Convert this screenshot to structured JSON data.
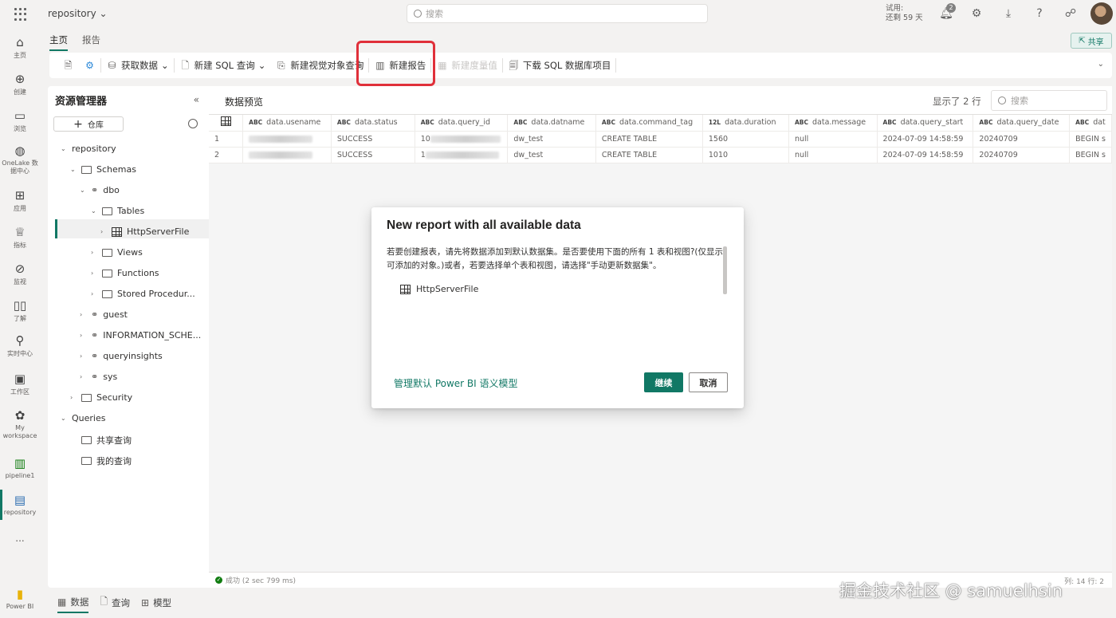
{
  "header": {
    "app_title": "repository",
    "search_placeholder": "搜索",
    "trial_line1": "试用:",
    "trial_line2": "还剩 59 天",
    "notification_count": "2"
  },
  "left_rail": {
    "items": [
      {
        "label": "主页",
        "icon": "home-icon"
      },
      {
        "label": "创建",
        "icon": "create-icon"
      },
      {
        "label": "浏览",
        "icon": "browse-icon"
      },
      {
        "label": "OneLake 数据中心",
        "icon": "onelake-icon"
      },
      {
        "label": "应用",
        "icon": "apps-icon"
      },
      {
        "label": "指标",
        "icon": "trophy-icon"
      },
      {
        "label": "监视",
        "icon": "monitor-icon"
      },
      {
        "label": "了解",
        "icon": "book-icon"
      },
      {
        "label": "实时中心",
        "icon": "realtime-icon"
      },
      {
        "label": "工作区",
        "icon": "workspaces-icon"
      },
      {
        "label": "My workspace",
        "icon": "my-workspace-icon"
      },
      {
        "label": "pipeline1",
        "icon": "pipeline-icon"
      },
      {
        "label": "repository",
        "icon": "warehouse-icon"
      },
      {
        "label": "...",
        "icon": "more-icon"
      },
      {
        "label": "Power BI",
        "icon": "powerbi-icon"
      }
    ]
  },
  "tabs": {
    "home": "主页",
    "report": "报告",
    "share": "共享"
  },
  "toolbar": {
    "get_data": "获取数据",
    "new_sql_query": "新建 SQL 查询",
    "new_visual_query": "新建视觉对象查询",
    "new_report": "新建报告",
    "new_measure": "新建度量值",
    "download_sql_project": "下载 SQL 数据库项目"
  },
  "explorer": {
    "title": "资源管理器",
    "add_warehouse": "仓库",
    "tree": {
      "repository": "repository",
      "schemas": "Schemas",
      "dbo": "dbo",
      "tables": "Tables",
      "httpserverfile": "HttpServerFile",
      "views": "Views",
      "functions": "Functions",
      "stored_procedures": "Stored Procedur...",
      "guest": "guest",
      "information_schema": "INFORMATION_SCHE...",
      "queryinsights": "queryinsights",
      "sys": "sys",
      "security": "Security",
      "queries": "Queries",
      "shared_queries": "共享查询",
      "my_queries": "我的查询"
    }
  },
  "preview": {
    "title": "数据预览",
    "rows_shown": "显示了 2 行",
    "search_placeholder": "搜索",
    "columns": [
      {
        "type": "ABC",
        "name": "data.usename"
      },
      {
        "type": "ABC",
        "name": "data.status"
      },
      {
        "type": "ABC",
        "name": "data.query_id"
      },
      {
        "type": "ABC",
        "name": "data.datname"
      },
      {
        "type": "ABC",
        "name": "data.command_tag"
      },
      {
        "type": "12L",
        "name": "data.duration"
      },
      {
        "type": "ABC",
        "name": "data.message"
      },
      {
        "type": "ABC",
        "name": "data.query_start"
      },
      {
        "type": "ABC",
        "name": "data.query_date"
      },
      {
        "type": "ABC",
        "name": "dat"
      }
    ],
    "rows": [
      {
        "n": "1",
        "status": "SUCCESS",
        "query_id_prefix": "10",
        "datname": "dw_test",
        "command_tag": "CREATE TABLE",
        "duration": "1560",
        "message": "null",
        "query_start": "2024-07-09 14:58:59",
        "query_date": "20240709",
        "extra": "BEGIN s"
      },
      {
        "n": "2",
        "status": "SUCCESS",
        "query_id_prefix": "1",
        "datname": "dw_test",
        "command_tag": "CREATE TABLE",
        "duration": "1010",
        "message": "null",
        "query_start": "2024-07-09 14:58:59",
        "query_date": "20240709",
        "extra": "BEGIN s"
      }
    ]
  },
  "status_bar": {
    "text": "成功 (2 sec 799 ms)",
    "right": "列: 14  行: 2"
  },
  "bottom_tabs": {
    "data": "数据",
    "query": "查询",
    "model": "模型"
  },
  "dialog": {
    "title": "New report with all available data",
    "body": "若要创建报表，请先将数据添加到默认数据集。是否要使用下面的所有 1 表和视图?(仅显示可添加的对象。)或者，若要选择单个表和视图，请选择\"手动更新数据集\"。",
    "item": "HttpServerFile",
    "manage_link": "管理默认 Power BI 语义模型",
    "continue": "继续",
    "cancel": "取消"
  },
  "watermark": "掘金技术社区 @ samuelhsin"
}
